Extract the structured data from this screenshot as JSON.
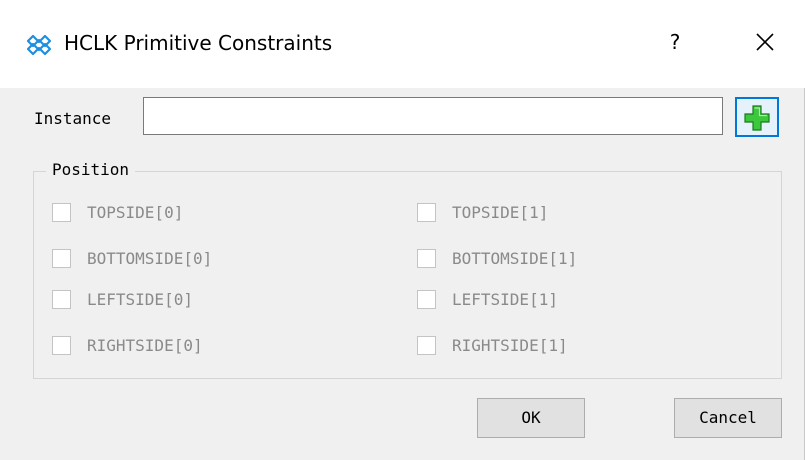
{
  "window": {
    "title": "HCLK Primitive Constraints",
    "help_label": "?",
    "icons": {
      "app": "gowin-logo-icon",
      "close": "close-icon"
    }
  },
  "instance": {
    "label": "Instance",
    "value": "",
    "add_icon": "green-plus-icon"
  },
  "position": {
    "title": "Position",
    "left_column": [
      {
        "label": "TOPSIDE[0]",
        "checked": false,
        "enabled": false
      },
      {
        "label": "BOTTOMSIDE[0]",
        "checked": false,
        "enabled": false
      },
      {
        "label": "LEFTSIDE[0]",
        "checked": false,
        "enabled": false
      },
      {
        "label": "RIGHTSIDE[0]",
        "checked": false,
        "enabled": false
      }
    ],
    "right_column": [
      {
        "label": "TOPSIDE[1]",
        "checked": false,
        "enabled": false
      },
      {
        "label": "BOTTOMSIDE[1]",
        "checked": false,
        "enabled": false
      },
      {
        "label": "LEFTSIDE[1]",
        "checked": false,
        "enabled": false
      },
      {
        "label": "RIGHTSIDE[1]",
        "checked": false,
        "enabled": false
      }
    ]
  },
  "buttons": {
    "ok": "OK",
    "cancel": "Cancel"
  },
  "colors": {
    "accent": "#0078d7",
    "plus_green": "#3cc83c",
    "disabled_text": "#8a8a8a"
  }
}
